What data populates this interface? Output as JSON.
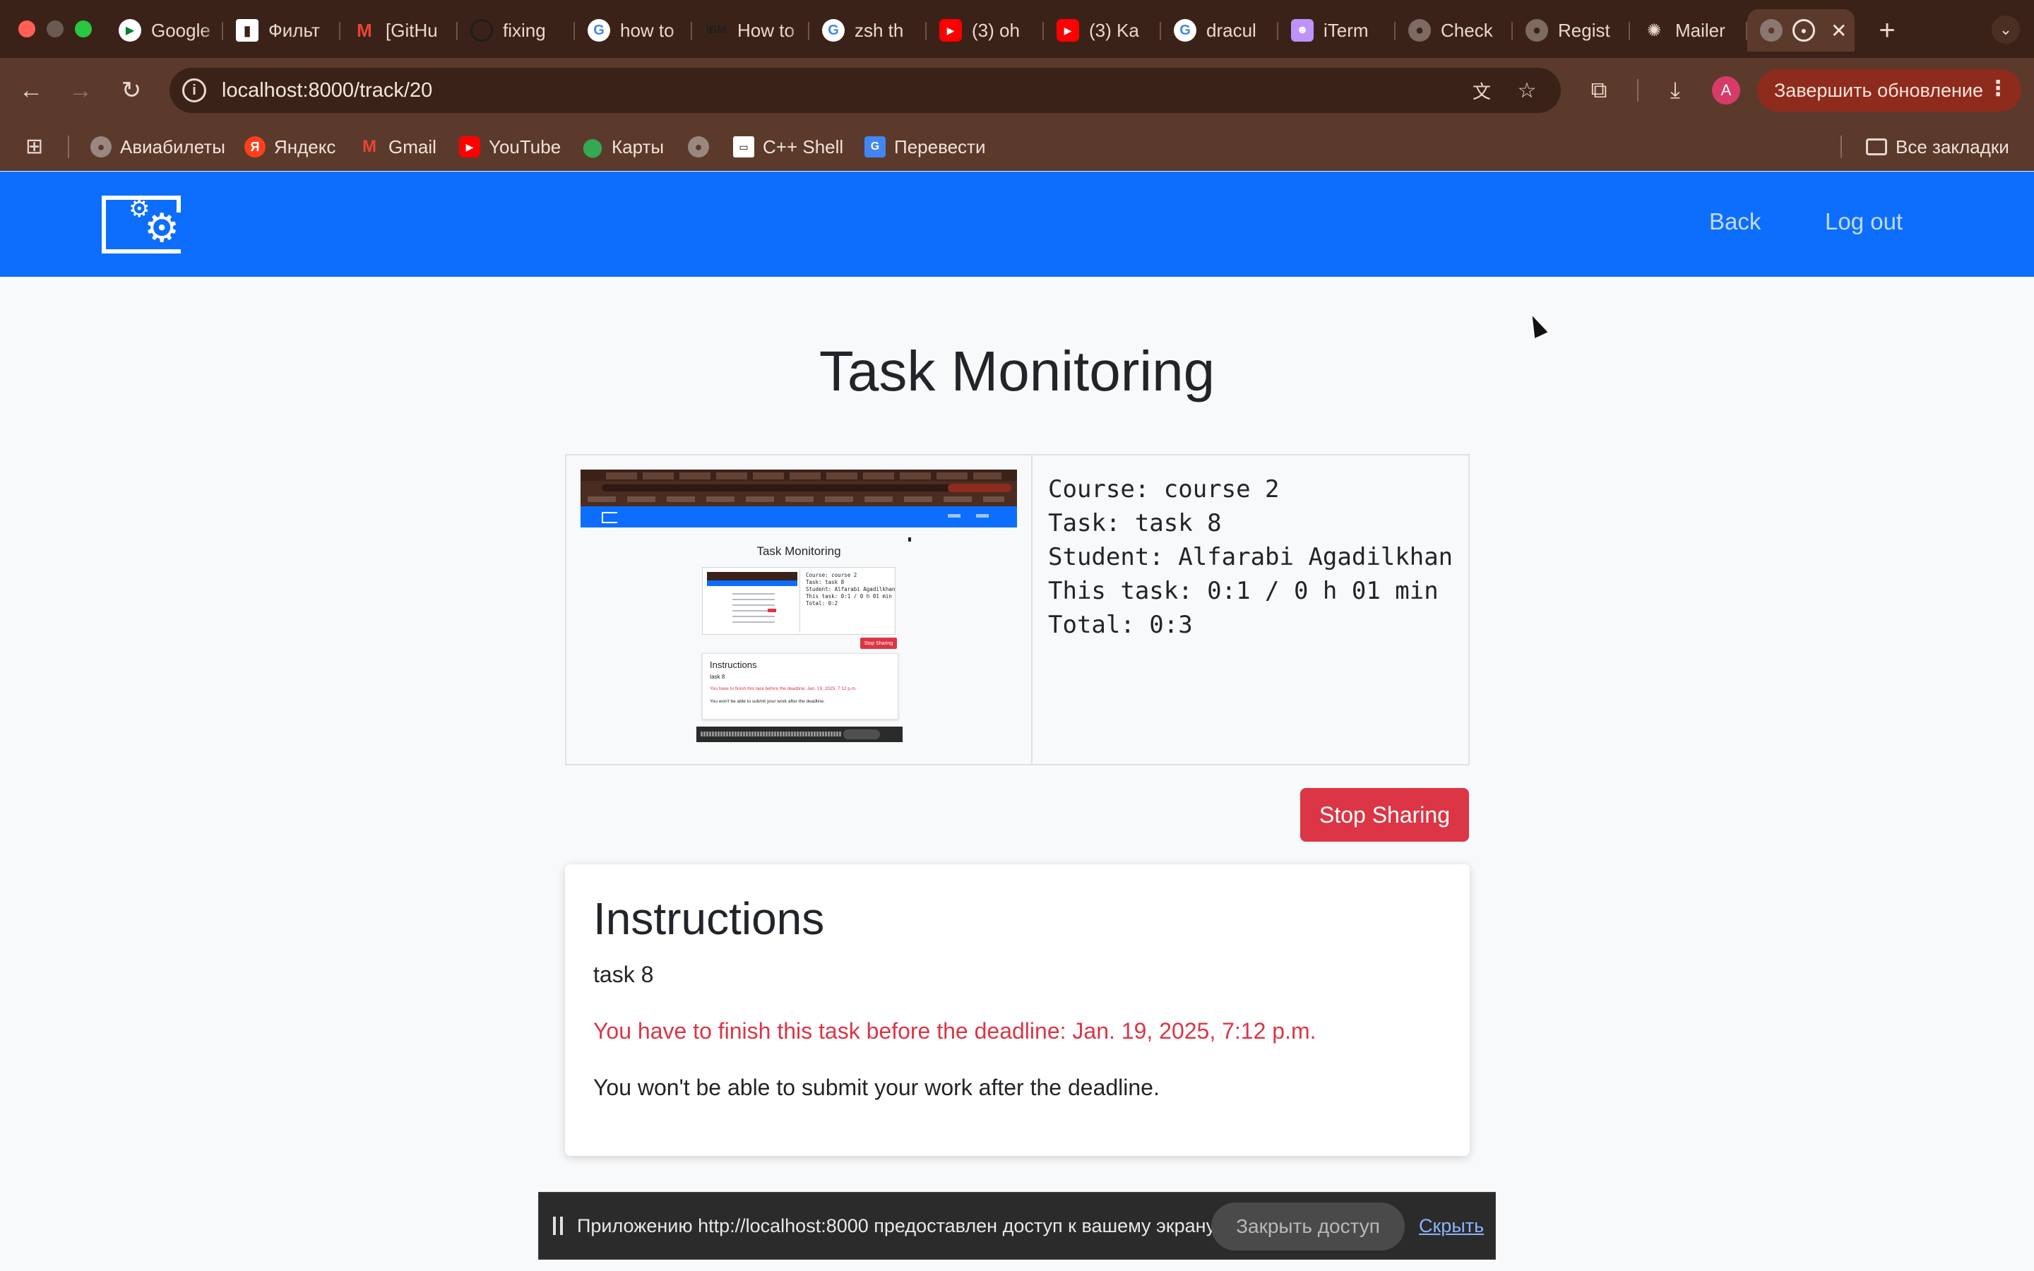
{
  "browser": {
    "tabs": [
      {
        "label": "Google",
        "icon": "google-meet-icon"
      },
      {
        "label": "Фильт",
        "icon": "trello-icon"
      },
      {
        "label": "[GitHu",
        "icon": "gmail-icon"
      },
      {
        "label": "fixing",
        "icon": "github-icon"
      },
      {
        "label": "how to",
        "icon": "google-icon"
      },
      {
        "label": "How to",
        "icon": "ibm-icon"
      },
      {
        "label": "zsh th",
        "icon": "google-icon"
      },
      {
        "label": "(3) oh",
        "icon": "youtube-icon"
      },
      {
        "label": "(3) Ka",
        "icon": "youtube-icon"
      },
      {
        "label": "dracul",
        "icon": "google-icon"
      },
      {
        "label": "iTerm",
        "icon": "dracula-icon"
      },
      {
        "label": "Check",
        "icon": "globe-icon"
      },
      {
        "label": "Regist",
        "icon": "globe-icon"
      },
      {
        "label": "Mailer",
        "icon": "openai-icon"
      }
    ],
    "active_tab": {
      "icon": "globe-icon",
      "recording_icon": "recording-icon",
      "close": "✕"
    },
    "new_tab": "+",
    "url": "localhost:8000/track/20",
    "update_button": "Завершить обновление",
    "avatar_letter": "A",
    "bookmarks": [
      {
        "label": "Авиабилеты",
        "icon": "globe-icon"
      },
      {
        "label": "Яндекс",
        "icon": "yandex-icon"
      },
      {
        "label": "Gmail",
        "icon": "gmail-icon"
      },
      {
        "label": "YouTube",
        "icon": "youtube-icon"
      },
      {
        "label": "Карты",
        "icon": "maps-pin-icon"
      },
      {
        "label": "",
        "icon": "globe-icon"
      },
      {
        "label": "C++ Shell",
        "icon": "cpp-shell-icon"
      },
      {
        "label": "Перевести",
        "icon": "translate-icon"
      }
    ],
    "all_bookmarks": "Все закладки"
  },
  "navbar": {
    "back": "Back",
    "logout": "Log out"
  },
  "page": {
    "title": "Task Monitoring",
    "monitor": {
      "course": "Course: course 2",
      "task": "Task: task 8",
      "student": "Student: Alfarabi Agadilkhan",
      "this_task": "This task: 0:1 / 0 h 01 min",
      "total": "Total: 0:3"
    },
    "stop_sharing": "Stop Sharing",
    "instructions": {
      "heading": "Instructions",
      "task": "task 8",
      "deadline": "You have to finish this task before the deadline: Jan. 19, 2025, 7:12 p.m.",
      "note": "You won't be able to submit your work after the deadline."
    }
  },
  "preview": {
    "title": "Task Monitoring",
    "info": "Course: course 2\nTask: task 8\nStudent: Alfarabi Agadilkhan\nThis task: 0:1 / 0 h 01 min\nTotal: 0:2",
    "stop": "Stop Sharing",
    "card_heading": "Instructions",
    "card_task": "task 8",
    "card_deadline": "You have to finish this task before the deadline: Jan. 19, 2025, 7:12 p.m.",
    "card_note": "You won't be able to submit your work after the deadline."
  },
  "share_bar": {
    "message": "Приложению http://localhost:8000 предоставлен доступ к вашему экрану.",
    "stop_access": "Закрыть доступ",
    "hide": "Скрыть"
  },
  "colors": {
    "navbar": "#0d6efd",
    "danger": "#dc3545",
    "chrome": "#5b3a2c"
  }
}
